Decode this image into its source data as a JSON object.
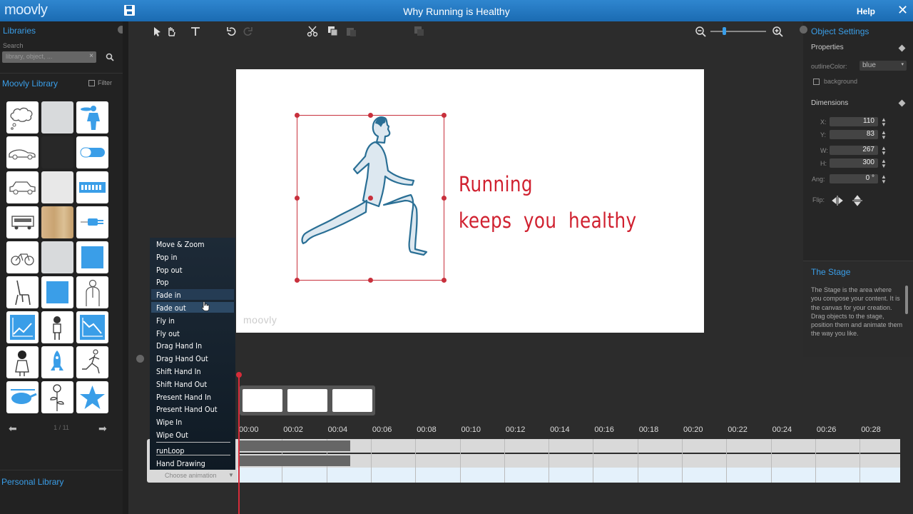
{
  "app": {
    "logo": "moovly",
    "title": "Why Running is Healthy",
    "help": "Help",
    "close": "✕"
  },
  "left": {
    "libraries_title": "Libraries",
    "search_label": "Search",
    "search_placeholder": "library, object, ...",
    "library_title": "Moovly Library",
    "filter_label": "Filter",
    "pager": "1 / 11",
    "personal_title": "Personal Library"
  },
  "stage": {
    "line1": "Running",
    "line2": "keeps  you  healthy",
    "watermark": "moovly"
  },
  "right": {
    "title": "Object Settings",
    "properties": "Properties",
    "outline_label": "outlineColor:",
    "outline_value": "blue",
    "background_label": "background",
    "dimensions": "Dimensions",
    "x_label": "X:",
    "x": "110",
    "y_label": "Y:",
    "y": "83",
    "w_label": "W:",
    "w": "267",
    "h_label": "H:",
    "h": "300",
    "ang_label": "Ang:",
    "ang": "0 °",
    "flip_label": "Flip:",
    "stage_title": "The Stage",
    "stage_desc": "The Stage is the area where you compose your content. It is the canvas for your creation. Drag objects to the stage, position them and animate them the way you like."
  },
  "timeline": {
    "ticks": [
      "00:00",
      "00:02",
      "00:04",
      "00:06",
      "00:08",
      "00:10",
      "00:12",
      "00:14",
      "00:16",
      "00:18",
      "00:20",
      "00:22",
      "00:24",
      "00:26",
      "00:28"
    ],
    "choose_animation": "Choose animation"
  },
  "animations": [
    "Move & Zoom",
    "Pop in",
    "Pop out",
    "Pop",
    "Fade in",
    "Fade out",
    "Fly in",
    "Fly out",
    "Drag Hand In",
    "Drag Hand Out",
    "Shift Hand In",
    "Shift Hand Out",
    "Present Hand In",
    "Present Hand Out",
    "Wipe In",
    "Wipe Out",
    "runLoop",
    "Hand Drawing"
  ],
  "colors": {
    "accent": "#3a9ee8",
    "stage_text": "#d0202f",
    "selection": "#c8303c",
    "drawing": "#2a6f95"
  }
}
